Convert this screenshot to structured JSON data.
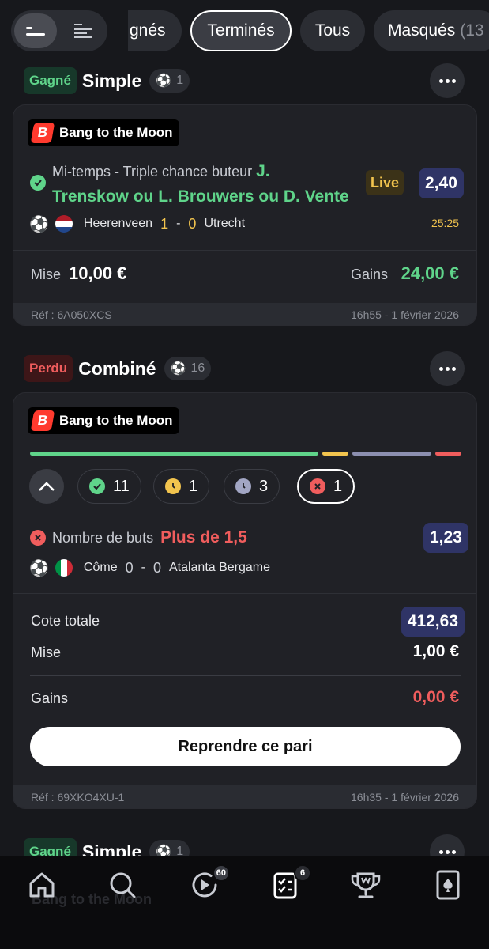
{
  "colors": {
    "background": "#17181c",
    "card": "#202126",
    "won": "#5fd48a",
    "lost": "#f05d5d",
    "pending": "#f2c44e",
    "odds_bg": "#2f3466"
  },
  "filters": {
    "tabs": [
      {
        "label": "gnés",
        "selected": false
      },
      {
        "label": "Terminés",
        "selected": true
      },
      {
        "label": "Tous",
        "selected": false
      },
      {
        "label": "Masqués (13",
        "selected": false
      }
    ]
  },
  "bets": [
    {
      "status": "Gagné",
      "type": "Simple",
      "sport_count": "1",
      "promo": "Bang to the Moon",
      "selection": {
        "market": "Mi-temps - Triple chance buteur",
        "pick_line1": "J.",
        "pick_line2": "Trenskow ou L. Brouwers ou D. Vente",
        "live": "Live",
        "odds": "2,40",
        "home": "Heerenveen",
        "home_score": "1",
        "sep": "-",
        "away_score": "0",
        "away": "Utrecht",
        "time": "25:25"
      },
      "stake_label": "Mise",
      "stake": "10,00 €",
      "gains_label": "Gains",
      "gains": "24,00 €",
      "ref": "Réf : 6A050XCS",
      "date": "16h55 - 1 février 2026"
    },
    {
      "status": "Perdu",
      "type": "Combiné",
      "sport_count": "16",
      "promo": "Bang to the Moon",
      "progress": {
        "won": 11,
        "pending": 1,
        "upcoming": 3,
        "lost": 1
      },
      "counts": {
        "won": "11",
        "pending": "1",
        "upcoming": "3",
        "lost": "1"
      },
      "selection": {
        "market": "Nombre de buts",
        "pick": "Plus de 1,5",
        "odds": "1,23",
        "home": "Côme",
        "home_score": "0",
        "sep": "-",
        "away_score": "0",
        "away": "Atalanta Bergame"
      },
      "total_odds_label": "Cote totale",
      "total_odds": "412,63",
      "stake_label": "Mise",
      "stake": "1,00 €",
      "gains_label": "Gains",
      "gains": "0,00 €",
      "cta": "Reprendre ce pari",
      "ref": "Réf : 69XKO4XU-1",
      "date": "16h35 - 1 février 2026"
    },
    {
      "status": "Gagné",
      "type": "Simple",
      "sport_count": "1",
      "promo": "Bang to the Moon"
    }
  ],
  "nav": {
    "live_badge": "60",
    "bets_badge": "6",
    "items": [
      "home-icon",
      "search-icon",
      "live-play-icon",
      "my-bets-icon",
      "trophy-icon",
      "casino-card-icon"
    ]
  }
}
